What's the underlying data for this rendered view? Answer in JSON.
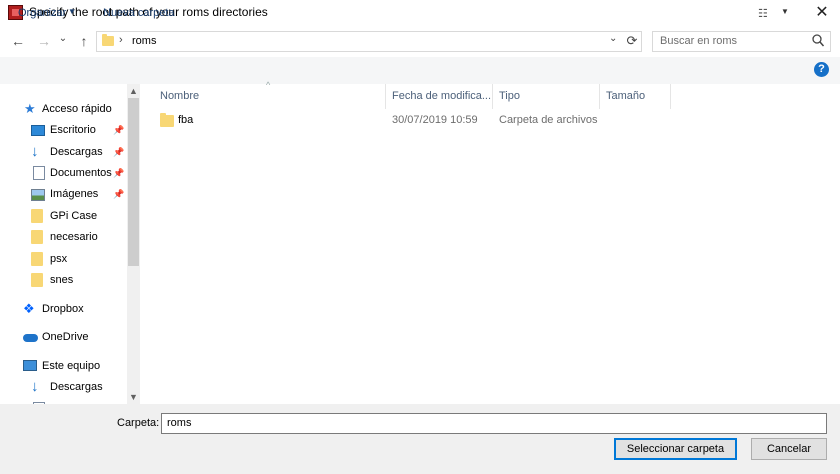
{
  "window": {
    "title": "Specify the root path of your roms directories",
    "close_glyph": "✕"
  },
  "nav": {
    "back": "←",
    "forward": "→",
    "history": "⌄",
    "up": "↑"
  },
  "address": {
    "chevron": "›",
    "path": "roms",
    "dropdown": "⌄",
    "refresh": "⟳"
  },
  "search": {
    "placeholder": "Buscar en roms",
    "icon": "search-icon"
  },
  "toolbar": {
    "organize": "Organizar",
    "organize_arrow": "▼",
    "new_folder": "Nueva carpeta",
    "view_glyph": "☷",
    "view_arrow": "▼",
    "help": "?"
  },
  "sidebar": {
    "quick_access": "Acceso rápido",
    "items": [
      {
        "label": "Escritorio",
        "icon": "desktop-icon",
        "pinned": true
      },
      {
        "label": "Descargas",
        "icon": "download-icon",
        "pinned": true
      },
      {
        "label": "Documentos",
        "icon": "document-icon",
        "pinned": true
      },
      {
        "label": "Imágenes",
        "icon": "pictures-icon",
        "pinned": true
      },
      {
        "label": "GPi Case",
        "icon": "folder-icon",
        "pinned": false
      },
      {
        "label": "necesario",
        "icon": "folder-icon",
        "pinned": false
      },
      {
        "label": "psx",
        "icon": "folder-icon",
        "pinned": false
      },
      {
        "label": "snes",
        "icon": "folder-icon",
        "pinned": false
      }
    ],
    "dropbox": "Dropbox",
    "onedrive": "OneDrive",
    "this_pc": "Este equipo",
    "pc_items": [
      {
        "label": "Descargas",
        "icon": "download-icon"
      }
    ],
    "pin_glyph": "📌"
  },
  "columns": {
    "name": "Nombre",
    "date": "Fecha de modifica...",
    "type": "Tipo",
    "size": "Tamaño"
  },
  "files": [
    {
      "name": "fba",
      "date": "30/07/2019 10:59",
      "type": "Carpeta de archivos",
      "size": ""
    }
  ],
  "footer": {
    "folder_label": "Carpeta:",
    "folder_value": "roms",
    "select_button": "Seleccionar carpeta",
    "cancel_button": "Cancelar"
  },
  "colors": {
    "folder": "#f8d775",
    "link": "#1a3e6e",
    "accent": "#0078d7",
    "help": "#1670c8",
    "quick_access_star": "#2b7bd6"
  }
}
